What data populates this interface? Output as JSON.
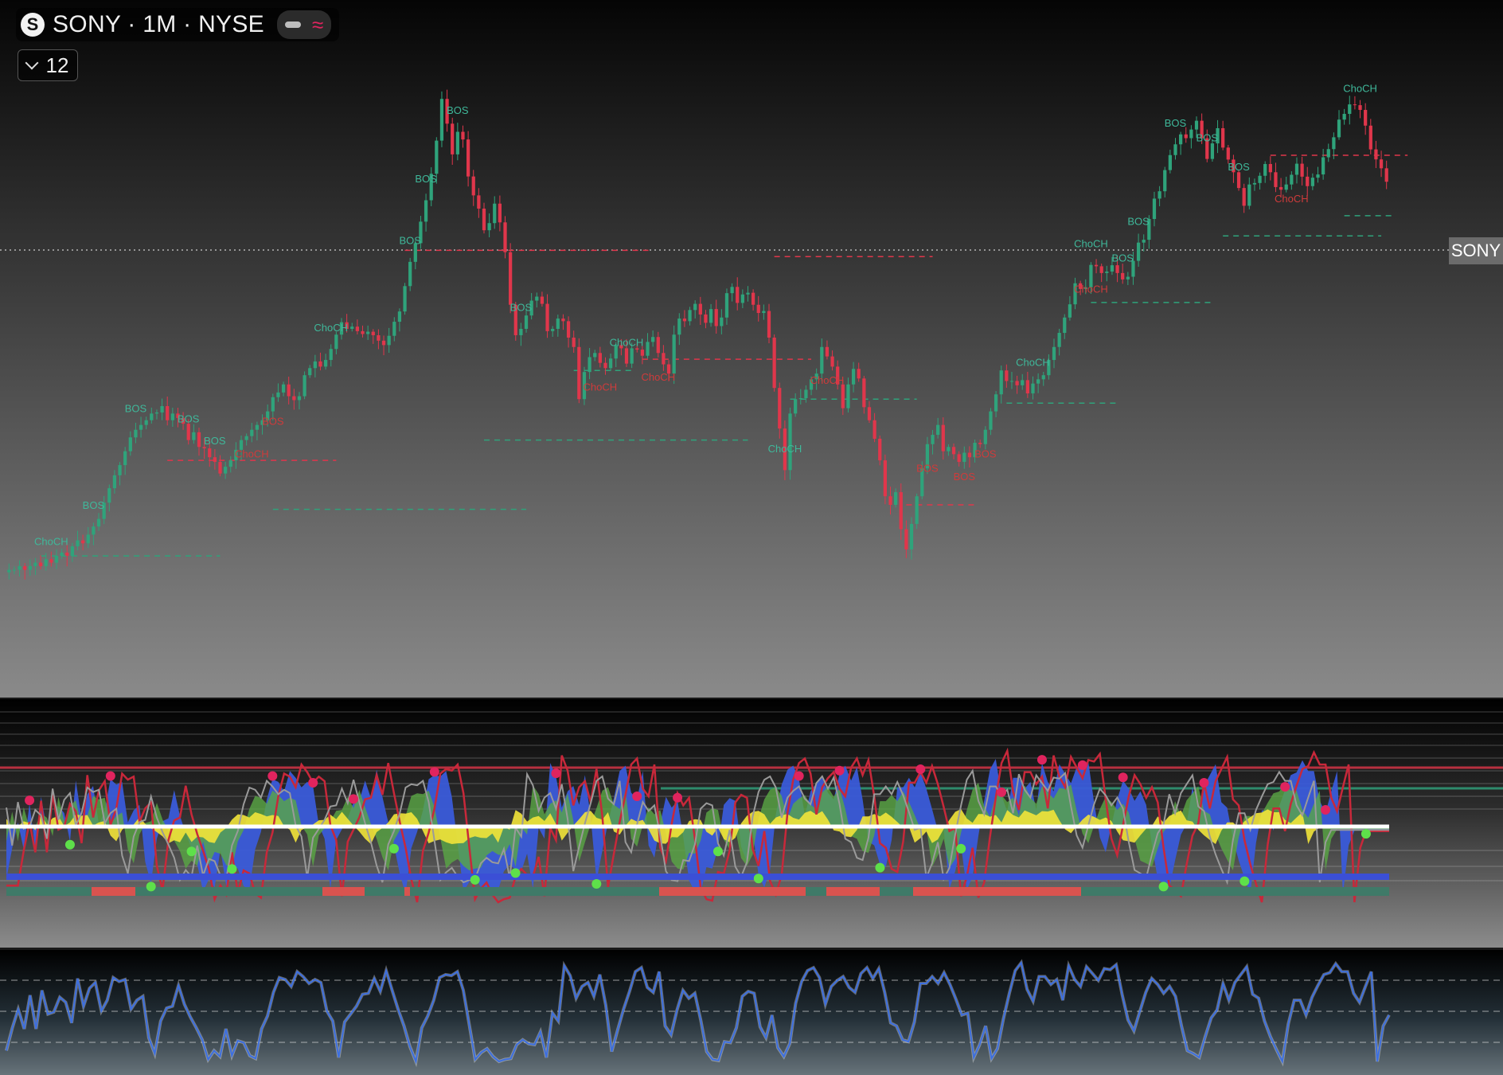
{
  "header": {
    "symbol_logo": "S",
    "title": "SONY · 1M · NYSE",
    "collapse_count": "12",
    "price_tag": "SONY",
    "icons": [
      "minus-icon",
      "approx-icon",
      "chevron-down-icon"
    ]
  },
  "colors": {
    "bull": "#2fa37b",
    "bull_text": "#3fb89a",
    "bear": "#e0364b",
    "bear_text": "#cf3b3b",
    "wave_blue": "#3a5bd9",
    "wave_green": "#5aa845",
    "wave_yellow": "#f2e43a",
    "rsi_line": "#3d6fe0",
    "zero_line": "#ffffff"
  },
  "chart_data": [
    {
      "type": "candlestick",
      "series": [
        {
          "values": [
            3.5,
            3.5,
            3.6,
            3.5,
            3.6,
            3.7,
            3.6,
            3.8,
            3.7,
            3.9,
            4,
            3.9,
            4.2,
            4.4,
            4.3,
            4.6,
            4.9,
            5.2,
            5.9,
            6.6,
            7.3,
            7.9,
            8.8,
            9.8,
            10.4,
            10.8,
            11.2,
            11.8,
            11.9,
            12.5,
            11.2,
            11.8,
            11.4,
            10.9,
            9.6,
            10.2,
            9.1,
            9,
            8.4,
            8.1,
            7.4,
            7.8,
            8.2,
            8.9,
            9.6,
            9.9,
            10.4,
            10.8,
            11.2,
            12,
            13.4,
            13.9,
            14.8,
            13.5,
            13.1,
            13.5,
            15.9,
            16.8,
            17.7,
            17,
            17.9,
            19.5,
            21.8,
            24,
            22.8,
            23.2,
            22.4,
            21.9,
            22.3,
            21.7,
            20.8,
            20.1,
            21.6,
            24.1,
            26.1,
            31.8,
            38.4,
            44.4,
            52.5,
            62,
            76.2,
            98.6,
            136.4,
            112.5,
            88.6,
            105.6,
            99.5,
            74.6,
            64.4,
            58.1,
            49.1,
            51.9,
            60.4,
            52.2,
            41.4,
            27.5,
            21.7,
            22.8,
            25.3,
            28.4,
            29.3,
            27.7,
            22.4,
            22.8,
            24.7,
            24.2,
            21.3,
            19.8,
            13.2,
            16.3,
            18.3,
            18.9,
            17.5,
            16.8,
            18.1,
            20.1,
            19.6,
            17.4,
            19.6,
            19.4,
            18.5,
            20.6,
            21.4,
            18.9,
            17.3,
            16.1,
            21.8,
            24.7,
            24.2,
            26.4,
            27.7,
            25.5,
            23.9,
            26.6,
            23.3,
            24.9,
            30.1,
            31.6,
            27.9,
            29.8,
            30.2,
            27.5,
            25.8,
            26.2,
            21.3,
            14.4,
            10.5,
            7.6,
            11.8,
            13.2,
            13.3,
            14.2,
            15.4,
            16.1,
            19.8,
            18.4,
            17,
            14.8,
            12.3,
            14.8,
            16.7,
            15.5,
            12.4,
            11.2,
            9.7,
            8.2,
            6.2,
            5.8,
            6.4,
            4.8,
            4.1,
            5,
            6.2,
            7.7,
            9.3,
            10,
            10.8,
            8.8,
            9.1,
            8.6,
            8.1,
            8.7,
            8.4,
            9.4,
            9.3,
            10.4,
            12,
            13.7,
            16.5,
            15.2,
            15.2,
            14.7,
            15.3,
            13.8,
            14.9,
            15.4,
            15.9,
            17.9,
            19.8,
            22.1,
            24.9,
            27.6,
            32.5,
            31.1,
            31.5,
            37.5,
            37.1,
            35.2,
            35.6,
            37.4,
            35.2,
            33.5,
            34.2,
            38.7,
            44.6,
            45.6,
            53.6,
            62.8,
            66.5,
            78.4,
            88.1,
            95.8,
            103.5,
            100.5,
            107.5,
            115.1,
            100.4,
            85.5,
            96.5,
            108.6,
            93.4,
            85.1,
            77.1,
            68.2,
            59.4,
            70.1,
            70.9,
            75,
            82.2,
            77.1,
            68.7,
            67.3,
            70.1,
            75.6,
            82.4,
            74.5,
            69.2,
            73.9,
            75.8,
            86.6,
            92.3,
            101.2,
            116.1,
            121.4,
            130.7,
            129.9,
            125.2,
            110.8,
            92.1,
            85.2,
            79.5,
            71.6
          ]
        }
      ],
      "labels": [
        {
          "text": "ChoCH",
          "kind": "bull",
          "i": 8
        },
        {
          "text": "BOS",
          "kind": "bull",
          "i": 16
        },
        {
          "text": "BOS",
          "kind": "bull",
          "i": 24
        },
        {
          "text": "BOS",
          "kind": "bull",
          "i": 34
        },
        {
          "text": "BOS",
          "kind": "bull",
          "i": 39
        },
        {
          "text": "ChoCH",
          "kind": "bear",
          "i": 46
        },
        {
          "text": "BOS",
          "kind": "bear",
          "i": 50
        },
        {
          "text": "ChoCH",
          "kind": "bull",
          "i": 61
        },
        {
          "text": "BOS",
          "kind": "bull",
          "i": 76
        },
        {
          "text": "BOS",
          "kind": "bull",
          "i": 79
        },
        {
          "text": "BOS",
          "kind": "bull",
          "i": 85
        },
        {
          "text": "BOS",
          "kind": "bull",
          "i": 97
        },
        {
          "text": "ChoCH",
          "kind": "bear",
          "i": 112
        },
        {
          "text": "ChoCH",
          "kind": "bull",
          "i": 117
        },
        {
          "text": "ChoCH",
          "kind": "bear",
          "i": 123
        },
        {
          "text": "ChoCH",
          "kind": "bull",
          "i": 147
        },
        {
          "text": "ChoCH",
          "kind": "bear",
          "i": 155
        },
        {
          "text": "BOS",
          "kind": "bear",
          "i": 174
        },
        {
          "text": "BOS",
          "kind": "bear",
          "i": 181
        },
        {
          "text": "BOS",
          "kind": "bear",
          "i": 185
        },
        {
          "text": "ChoCH",
          "kind": "bull",
          "i": 194
        },
        {
          "text": "ChoCH",
          "kind": "bull",
          "i": 205
        },
        {
          "text": "ChoCH",
          "kind": "bear",
          "i": 205
        },
        {
          "text": "BOS",
          "kind": "bull",
          "i": 211
        },
        {
          "text": "BOS",
          "kind": "bull",
          "i": 214
        },
        {
          "text": "BOS",
          "kind": "bull",
          "i": 221
        },
        {
          "text": "BOS",
          "kind": "bull",
          "i": 227
        },
        {
          "text": "BOS",
          "kind": "bull",
          "i": 233
        },
        {
          "text": "ChoCH",
          "kind": "bear",
          "i": 243
        },
        {
          "text": "ChoCH",
          "kind": "bull",
          "i": 256
        },
        {
          "text": "BOS",
          "kind": "bull",
          "i": 265
        },
        {
          "text": "ChoCH",
          "kind": "bear",
          "i": 266
        }
      ]
    },
    {
      "type": "line",
      "ylim": [
        0,
        100
      ],
      "series": [
        {
          "values": [
            11,
            34,
            53,
            33,
            67,
            33,
            72,
            48,
            50,
            65,
            60,
            39,
            84,
            56,
            74,
            80,
            51,
            62,
            85,
            81,
            83,
            53,
            62,
            66,
            24,
            8,
            41,
            54,
            56,
            77,
            58,
            45,
            34,
            22,
            2,
            11,
            5,
            33,
            6,
            21,
            19,
            6,
            3,
            33,
            46,
            70,
            85,
            83,
            76,
            91,
            86,
            79,
            83,
            80,
            51,
            41,
            4,
            40,
            48,
            56,
            68,
            69,
            84,
            71,
            92,
            72,
            53,
            36,
            15,
            0,
            34,
            46,
            62,
            85,
            88,
            87,
            91,
            72,
            37,
            2,
            9,
            13,
            5,
            0,
            2,
            3,
            17,
            22,
            18,
            17,
            30,
            4,
            49,
            41,
            97,
            87,
            64,
            76,
            80,
            66,
            88,
            57,
            10,
            32,
            53,
            71,
            91,
            95,
            75,
            70,
            91,
            36,
            27,
            52,
            72,
            64,
            69,
            42,
            10,
            2,
            1,
            20,
            19,
            34,
            66,
            71,
            69,
            35,
            24,
            47,
            14,
            5,
            18,
            59,
            81,
            92,
            95,
            85,
            58,
            76,
            82,
            86,
            75,
            70,
            89,
            95,
            84,
            94,
            70,
            39,
            36,
            22,
            20,
            40,
            79,
            79,
            86,
            79,
            90,
            78,
            63,
            47,
            49,
            4,
            17,
            36,
            3,
            13,
            43,
            69,
            92,
            100,
            73,
            61,
            86,
            86,
            78,
            83,
            62,
            97,
            83,
            76,
            96,
            89,
            82,
            94,
            93,
            98,
            68,
            42,
            31,
            51,
            70,
            84,
            78,
            69,
            76,
            66,
            36,
            11,
            8,
            4,
            25,
            44,
            52,
            79,
            62,
            80,
            88,
            96,
            68,
            64,
            41,
            25,
            12,
            0,
            38,
            62,
            62,
            47,
            65,
            77,
            88,
            90,
            99,
            91,
            91,
            69,
            60,
            76,
            91,
            0,
            36,
            47
          ]
        }
      ]
    }
  ]
}
